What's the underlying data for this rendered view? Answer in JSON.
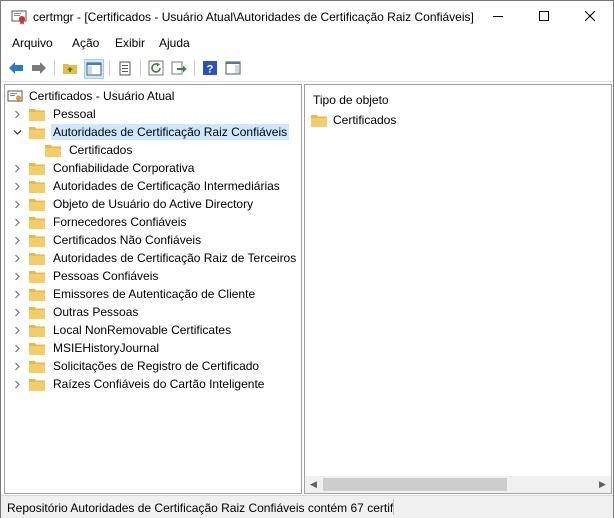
{
  "window": {
    "title": "certmgr - [Certificados - Usuário Atual\\Autoridades de Certificação Raiz Confiáveis]",
    "minimize": "—",
    "maximize": "☐",
    "close": "✕"
  },
  "menu": [
    "Arquivo",
    "Ação",
    "Exibir",
    "Ajuda"
  ],
  "tree": {
    "root": "Certificados - Usuário Atual",
    "items": [
      {
        "label": "Pessoal"
      },
      {
        "label": "Autoridades de Certificação Raiz Confiáveis",
        "expanded": true,
        "selected": true
      },
      {
        "label": "Certificados",
        "child": true
      },
      {
        "label": "Confiabilidade Corporativa"
      },
      {
        "label": "Autoridades de Certificação Intermediárias"
      },
      {
        "label": "Objeto de Usuário do Active Directory"
      },
      {
        "label": "Fornecedores Confiáveis"
      },
      {
        "label": "Certificados Não Confiáveis"
      },
      {
        "label": "Autoridades de Certificação Raiz de Terceiros"
      },
      {
        "label": "Pessoas Confiáveis"
      },
      {
        "label": "Emissores de Autenticação de Cliente"
      },
      {
        "label": "Outras Pessoas"
      },
      {
        "label": "Local NonRemovable Certificates"
      },
      {
        "label": "MSIEHistoryJournal"
      },
      {
        "label": "Solicitações de Registro de Certificado"
      },
      {
        "label": "Raízes Confiáveis do Cartão Inteligente"
      }
    ]
  },
  "list": {
    "header": "Tipo de objeto",
    "items": [
      "Certificados"
    ]
  },
  "status": {
    "text": "Repositório Autoridades de Certificação Raiz Confiáveis contém 67 certific"
  },
  "colors": {
    "folder": "#e8b84a",
    "selected": "#cce8ff"
  }
}
